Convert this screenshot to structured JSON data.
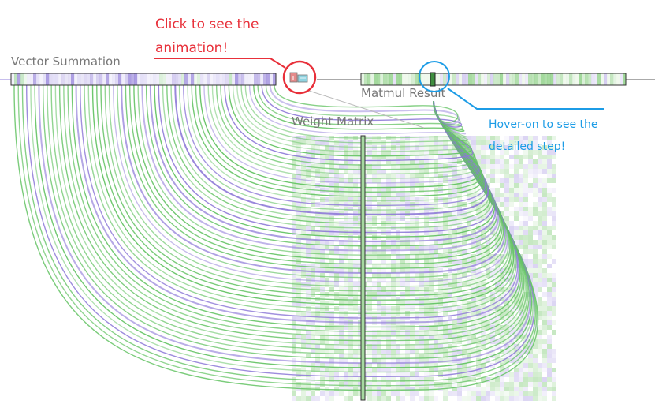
{
  "labels": {
    "vector_summation": "Vector Summation",
    "weight_matrix": "Weight Matrix",
    "matmul_result": "Matmul Result"
  },
  "annotations": {
    "click_line1": "Click to see the",
    "click_line2": "animation!",
    "hover_line1": "Hover-on to see the",
    "hover_line2": "detailed step!"
  },
  "colors": {
    "green": "#6cc46c",
    "purple": "#8f7ddb",
    "light_green": "#cfecc9",
    "light_purple": "#d8d2f2",
    "annotation_red": "#e8303a",
    "annotation_blue": "#1c9ce6",
    "label_gray": "#777777"
  },
  "icons": {
    "animation_button": "play-animation-icon"
  }
}
